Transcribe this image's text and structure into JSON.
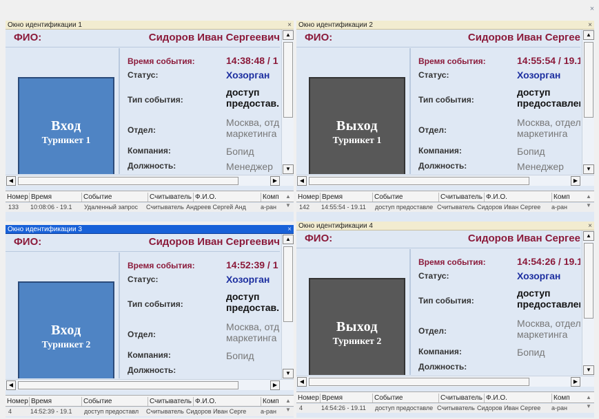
{
  "app": {
    "close_glyph": "×"
  },
  "labels": {
    "fio": "ФИО:",
    "event_time": "Время события:",
    "status": "Статус:",
    "event_type": "Тип события:",
    "department": "Отдел:",
    "company": "Компания:",
    "position": "Должность:"
  },
  "log_columns": [
    "Номер",
    "Время",
    "Событие",
    "Считыватель",
    "Ф.И.О.",
    "Комп"
  ],
  "windows": [
    {
      "title": "Окно идентификации 1",
      "active": false,
      "fio": "Сидоров Иван Сергеевич",
      "gate_main": "Вход",
      "gate_sub": "Турникет 1",
      "time": "14:38:48 / 1",
      "status": "Хозорган",
      "event_type": "доступ предостав.",
      "department_line1": "Москва, отд",
      "department_line2": "маркетинга",
      "company": "Бопид",
      "position": "Менеджер",
      "log_number": "133",
      "log_time": "10:08:06 - 19.1",
      "log_event": "Удаленный запрос",
      "log_reader": "Считыватель",
      "log_fio": "Андреев Сергей Анд",
      "log_company": "а-ран"
    },
    {
      "title": "Окно идентификации 2",
      "active": false,
      "fio": "Сидоров Иван Сергее",
      "gate_main": "Выход",
      "gate_sub": "Турникет 1",
      "time": "14:55:54 / 19.1",
      "status": "Хозорган",
      "event_type": "доступ предоставлен",
      "department_line1": "Москва, отдел",
      "department_line2": "маркетинга",
      "company": "Бопид",
      "position": "Менеджер",
      "log_number": "142",
      "log_time": "14:55:54 - 19.11",
      "log_event": "доступ предоставле",
      "log_reader": "Считыватель",
      "log_fio": "Сидоров Иван Сергее",
      "log_company": "а-ран"
    },
    {
      "title": "Окно идентификации 3",
      "active": true,
      "fio": "Сидоров Иван Сергеевич",
      "gate_main": "Вход",
      "gate_sub": "Турникет 2",
      "time": "14:52:39 / 1",
      "status": "Хозорган",
      "event_type": "доступ предостав.",
      "department_line1": "Москва, отд",
      "department_line2": "маркетинга",
      "company": "Бопид",
      "position": "",
      "log_number": "4",
      "log_time": "14:52:39 - 19.1",
      "log_event": "доступ предоставл",
      "log_reader": "Считыватель",
      "log_fio": "Сидоров Иван Серге",
      "log_company": "а-ран"
    },
    {
      "title": "Окно идентификации 4",
      "active": false,
      "fio": "Сидоров Иван Сергее",
      "gate_main": "Выход",
      "gate_sub": "Турникет 2",
      "time": "14:54:26 / 19.1",
      "status": "Хозорган",
      "event_type": "доступ предоставлен",
      "department_line1": "Москва, отдел",
      "department_line2": "маркетинга",
      "company": "Бопид",
      "position": "",
      "log_number": "4",
      "log_time": "14:54:26 - 19.11",
      "log_event": "доступ предоставле",
      "log_reader": "Считыватель",
      "log_fio": "Сидоров Иван Сергее",
      "log_company": "а-ран"
    }
  ],
  "colors": {
    "label_red": "#8b1a3a",
    "value_blue": "#1d2fa0",
    "gate_blue": "#4f84c4",
    "gate_dark": "#585858",
    "active_title": "#1861d8"
  }
}
